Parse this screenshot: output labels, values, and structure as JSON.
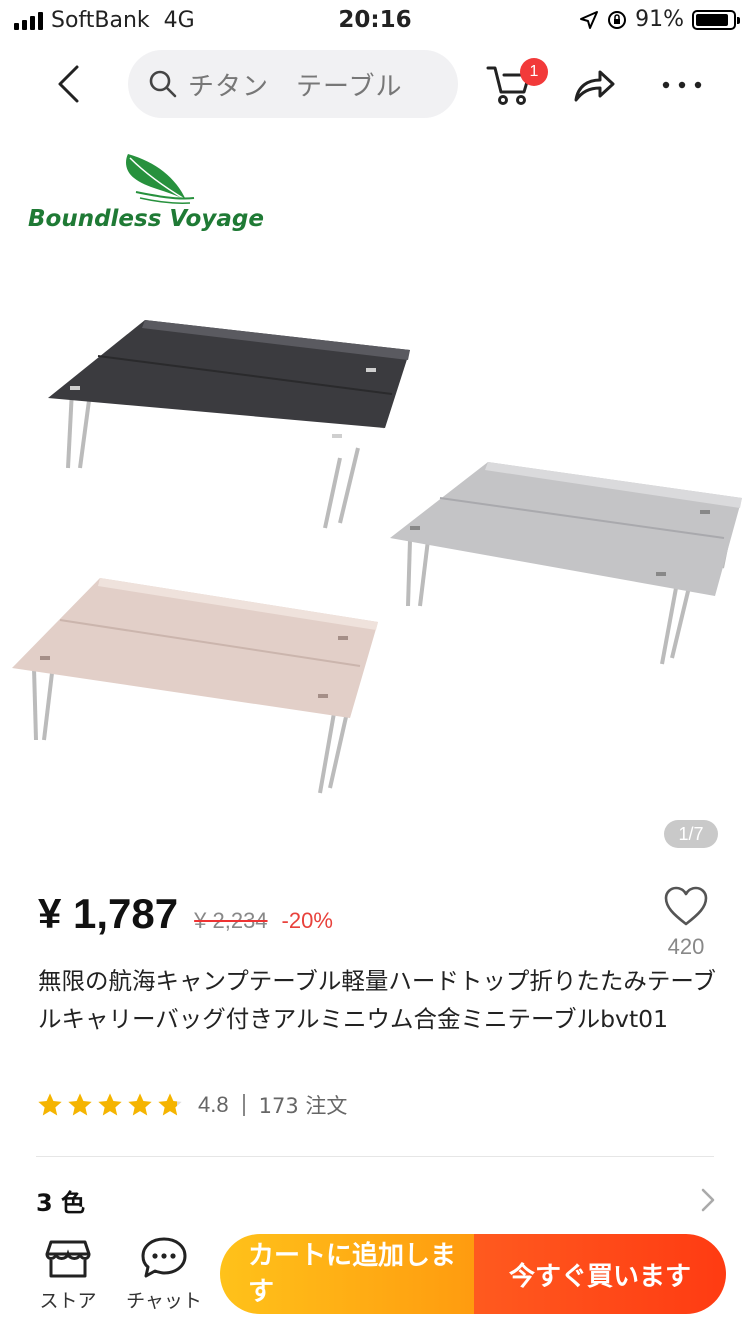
{
  "status_bar": {
    "carrier": "SoftBank",
    "network": "4G",
    "time": "20:16",
    "battery": "91%"
  },
  "nav": {
    "search_query": "チタン　テーブル",
    "cart_count": "1"
  },
  "gallery": {
    "brand_name": "Boundless Voyage",
    "page_indicator": "1/7",
    "table_colors": [
      "#3b3b3f",
      "#c4c4c6",
      "#e2cfc8"
    ]
  },
  "product": {
    "price": "¥ 1,787",
    "original_price": "¥ 2,234",
    "discount": "-20%",
    "wishlist_count": "420",
    "title": "無限の航海キャンプテーブル軽量ハードトップ折りたたみテーブルキャリーバッグ付きアルミニウム合金ミニテーブルbvt01",
    "rating": "4.8",
    "orders": "173 注文",
    "variant_label": "3 色"
  },
  "bottom_bar": {
    "store_label": "ストア",
    "chat_label": "チャット",
    "add_to_cart": "カートに追加します",
    "buy_now": "今すぐ買います"
  },
  "colors": {
    "accent_red": "#e8413b",
    "cart_orange": "#ffb015",
    "buy_red": "#ff4416",
    "star": "#f5b400"
  }
}
